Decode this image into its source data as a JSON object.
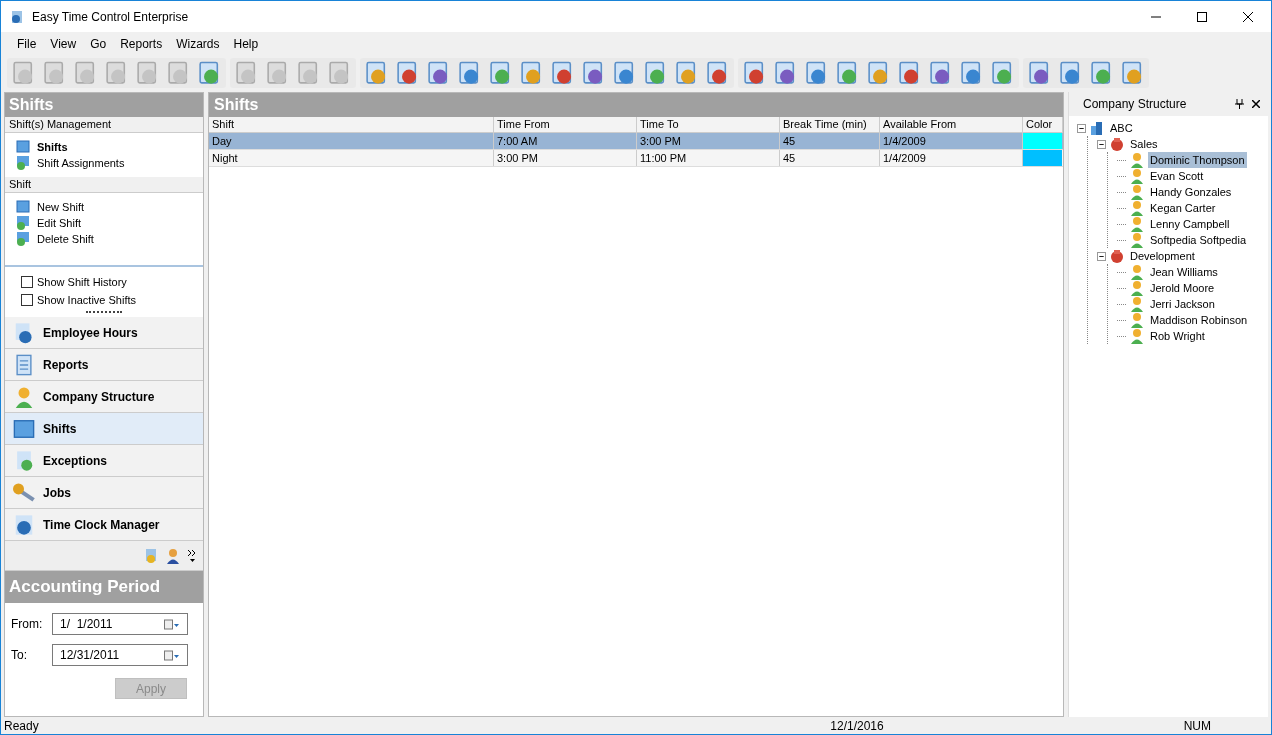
{
  "window": {
    "title": "Easy Time Control Enterprise"
  },
  "menu": [
    "File",
    "View",
    "Go",
    "Reports",
    "Wizards",
    "Help"
  ],
  "toolbar": [
    [
      {
        "disabled": true
      },
      {
        "disabled": true
      },
      {
        "disabled": true
      },
      {
        "disabled": true
      },
      {
        "disabled": true
      },
      {
        "disabled": true
      },
      {
        "disabled": false
      }
    ],
    [
      {
        "disabled": true
      },
      {
        "disabled": true
      },
      {
        "disabled": true
      },
      {
        "disabled": true
      }
    ],
    [
      {
        "disabled": false
      },
      {
        "disabled": false
      },
      {
        "disabled": false
      },
      {
        "disabled": false
      },
      {
        "disabled": false
      },
      {
        "disabled": false
      },
      {
        "disabled": false
      },
      {
        "disabled": false
      },
      {
        "disabled": false
      },
      {
        "disabled": false
      },
      {
        "disabled": false
      },
      {
        "disabled": false
      }
    ],
    [
      {
        "disabled": false
      },
      {
        "disabled": false
      },
      {
        "disabled": false
      },
      {
        "disabled": false
      },
      {
        "disabled": false
      },
      {
        "disabled": false
      },
      {
        "disabled": false
      },
      {
        "disabled": false
      },
      {
        "disabled": false
      }
    ],
    [
      {
        "disabled": false
      },
      {
        "disabled": false
      },
      {
        "disabled": false
      },
      {
        "disabled": false
      }
    ]
  ],
  "sidebar": {
    "title": "Shifts",
    "sections": [
      {
        "heading": "Shift(s) Management",
        "items": [
          {
            "label": "Shifts",
            "selected": true
          },
          {
            "label": "Shift Assignments",
            "selected": false
          }
        ]
      },
      {
        "heading": "Shift",
        "items": [
          {
            "label": "New Shift",
            "selected": false
          },
          {
            "label": "Edit Shift",
            "selected": false
          },
          {
            "label": "Delete Shift",
            "selected": false
          }
        ]
      }
    ],
    "options": [
      {
        "label": "Show Shift History",
        "checked": false
      },
      {
        "label": "Show Inactive Shifts",
        "checked": false
      }
    ],
    "nav": [
      {
        "label": "Employee Hours",
        "selected": false
      },
      {
        "label": "Reports",
        "selected": false
      },
      {
        "label": "Company Structure",
        "selected": false
      },
      {
        "label": "Shifts",
        "selected": true
      },
      {
        "label": "Exceptions",
        "selected": false
      },
      {
        "label": "Jobs",
        "selected": false
      },
      {
        "label": "Time Clock Manager",
        "selected": false
      }
    ]
  },
  "accounting_period": {
    "title": "Accounting Period",
    "fields": [
      {
        "label": "From:",
        "value": "1/  1/2011"
      },
      {
        "label": "To:",
        "value": "12/31/2011"
      }
    ],
    "apply": {
      "label": "Apply",
      "disabled": true
    }
  },
  "table": {
    "title": "Shifts",
    "columns": [
      "Shift",
      "Time From",
      "Time To",
      "Break Time (min)",
      "Available From",
      "Color"
    ],
    "rows": [
      {
        "cells": [
          "Day",
          "7:00 AM",
          "3:00 PM",
          "45",
          "1/4/2009"
        ],
        "color": "#00ffff",
        "selected": true
      },
      {
        "cells": [
          "Night",
          "3:00 PM",
          "11:00 PM",
          "45",
          "1/4/2009"
        ],
        "color": "#00bfff",
        "selected": false
      }
    ]
  },
  "company_structure": {
    "title": "Company Structure",
    "tree": [
      {
        "label": "ABC",
        "kind": "company",
        "expanded": true,
        "selected": false,
        "children": [
          {
            "label": "Sales",
            "kind": "department",
            "expanded": true,
            "selected": false,
            "children": [
              {
                "label": "Dominic Thompson",
                "kind": "employee",
                "selected": true
              },
              {
                "label": "Evan Scott",
                "kind": "employee",
                "selected": false
              },
              {
                "label": "Handy Gonzales",
                "kind": "employee",
                "selected": false
              },
              {
                "label": "Kegan Carter",
                "kind": "employee",
                "selected": false
              },
              {
                "label": "Lenny Campbell",
                "kind": "employee",
                "selected": false
              },
              {
                "label": "Softpedia Softpedia",
                "kind": "employee",
                "selected": false
              }
            ]
          },
          {
            "label": "Development",
            "kind": "department",
            "expanded": true,
            "selected": false,
            "children": [
              {
                "label": "Jean Williams",
                "kind": "employee",
                "selected": false
              },
              {
                "label": "Jerold Moore",
                "kind": "employee",
                "selected": false
              },
              {
                "label": "Jerri Jackson",
                "kind": "employee",
                "selected": false
              },
              {
                "label": "Maddison Robinson",
                "kind": "employee",
                "selected": false
              },
              {
                "label": "Rob Wright",
                "kind": "employee",
                "selected": false
              }
            ]
          }
        ]
      }
    ]
  },
  "status_bar": {
    "message": "Ready",
    "date": "12/1/2016",
    "keys": "NUM"
  }
}
